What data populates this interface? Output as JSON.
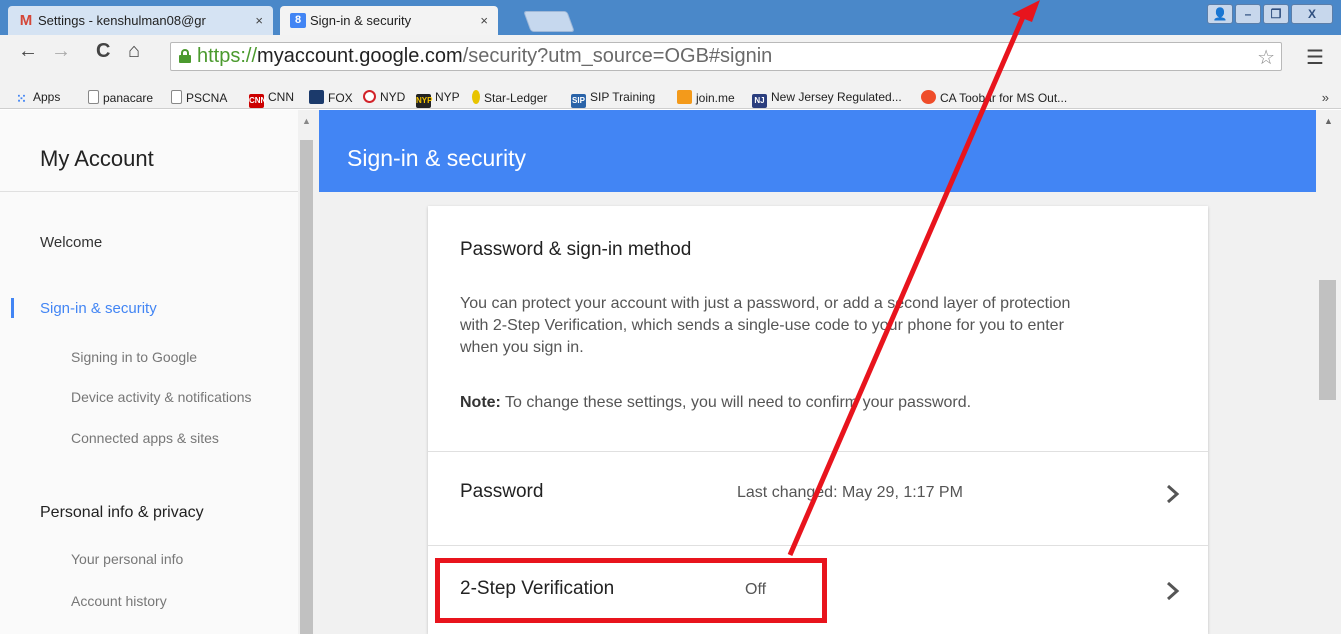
{
  "browser": {
    "tabs": [
      {
        "label": "Settings - kenshulman08@gr",
        "icon": "gmail-icon",
        "active": false
      },
      {
        "label": "Sign-in & security",
        "icon": "google-icon",
        "active": true
      }
    ],
    "tab_close_glyph": "×",
    "window_buttons": {
      "user": "👤",
      "minimize": "–",
      "restore": "❐",
      "close": "X"
    },
    "nav": {
      "back": "←",
      "forward": "→",
      "reload": "C",
      "home": "⌂"
    },
    "url": {
      "scheme": "https://",
      "host": "myaccount.google.com",
      "path": "/security?utm_source=OGB#signin"
    },
    "bookmarks": [
      {
        "label": "Apps",
        "icon": "apps-icon"
      },
      {
        "label": "panacare",
        "icon": "page-icon"
      },
      {
        "label": "PSCNA",
        "icon": "page-icon"
      },
      {
        "label": "CNN",
        "icon": "cnn-icon",
        "badge": "CNN"
      },
      {
        "label": "FOX",
        "icon": "fox-icon",
        "badge": ""
      },
      {
        "label": "NYD",
        "icon": "nyd-icon",
        "badge": ""
      },
      {
        "label": "NYP",
        "icon": "nyp-icon",
        "badge": "NYP"
      },
      {
        "label": "Star-Ledger",
        "icon": "star-ledger-icon",
        "badge": ""
      },
      {
        "label": "SIP Training",
        "icon": "sip-icon",
        "badge": "SIP"
      },
      {
        "label": "join.me",
        "icon": "joinme-icon",
        "badge": ""
      },
      {
        "label": "New Jersey Regulated...",
        "icon": "nj-icon",
        "badge": "NJ"
      },
      {
        "label": "CA Toobar for MS Out...",
        "icon": "ca-icon",
        "badge": ""
      }
    ],
    "bookmarks_more": "»",
    "colors": {
      "tabstrip": "#4a88c9",
      "secure": "#4b9a2e"
    }
  },
  "sidebar": {
    "brand": "My Account",
    "welcome": "Welcome",
    "security": {
      "label": "Sign-in & security",
      "items": [
        "Signing in to Google",
        "Device activity & notifications",
        "Connected apps & sites"
      ]
    },
    "privacy": {
      "label": "Personal info & privacy",
      "items": [
        "Your personal info",
        "Account history"
      ]
    },
    "accent": "#4285f4"
  },
  "main": {
    "title": "Sign-in & security",
    "card": {
      "title": "Password & sign-in method",
      "description": "You can protect your account with just a password, or add a second layer of protection with 2-Step Verification, which sends a single-use code to your phone for you to enter when you sign in.",
      "note_label": "Note:",
      "note_text": " To change these settings, you will need to confirm your password.",
      "rows": [
        {
          "label": "Password",
          "value": "Last changed: May 29, 1:17 PM"
        },
        {
          "label": "2-Step Verification",
          "value": "Off"
        }
      ]
    }
  },
  "annotation": {
    "color": "#e8141d",
    "highlighted": "2-Step Verification"
  }
}
